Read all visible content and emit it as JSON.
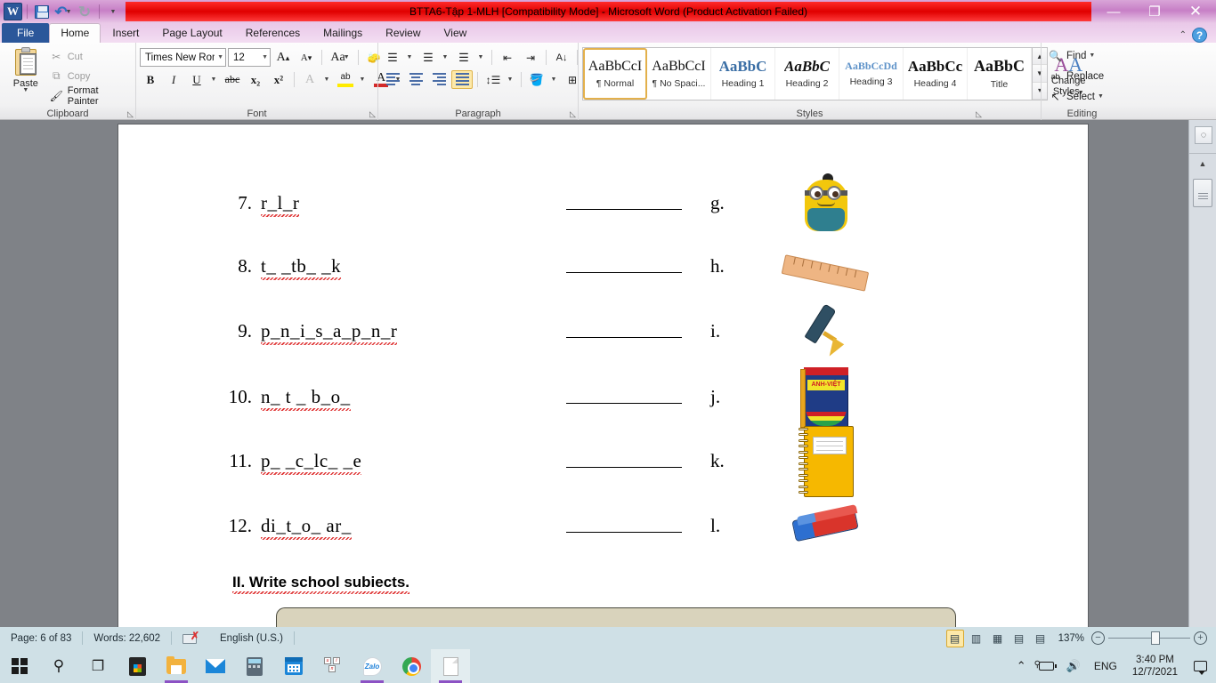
{
  "titlebar": {
    "document_title": "BTTA6-Tập 1-MLH [Compatibility Mode]  -  Microsoft Word (Product Activation Failed)",
    "app_logo": "word-logo",
    "quick_access": [
      {
        "name": "save",
        "icon": "save-icon"
      },
      {
        "name": "undo",
        "icon": "undo-icon",
        "glyph": "↰"
      },
      {
        "name": "redo",
        "icon": "redo-icon",
        "glyph": "↻"
      },
      {
        "name": "customize-qat",
        "icon": "chevron-down-icon",
        "glyph": "⋶"
      }
    ],
    "window_controls": {
      "minimize": "—",
      "restore": "❐",
      "close": "✕"
    }
  },
  "tabs": {
    "file": "File",
    "items": [
      {
        "label": "Home",
        "active": true
      },
      {
        "label": "Insert",
        "active": false
      },
      {
        "label": "Page Layout",
        "active": false
      },
      {
        "label": "References",
        "active": false
      },
      {
        "label": "Mailings",
        "active": false
      },
      {
        "label": "Review",
        "active": false
      },
      {
        "label": "View",
        "active": false
      }
    ],
    "collapse_ribbon": "⌃",
    "help": "?"
  },
  "ribbon": {
    "clipboard": {
      "group_label": "Clipboard",
      "paste_label": "Paste",
      "cut_label": "Cut",
      "copy_label": "Copy",
      "format_painter_label": "Format Painter"
    },
    "font": {
      "group_label": "Font",
      "font_name": "Times New Rom",
      "font_size": "12",
      "grow_font": "A",
      "shrink_font": "A",
      "change_case": "Aa",
      "clear_formatting": "⌫",
      "bold": "B",
      "italic": "I",
      "underline": "U",
      "strikethrough": "abc",
      "subscript": "x₂",
      "superscript": "x²",
      "text_effects": "A",
      "highlight": "ab",
      "font_color": "A"
    },
    "paragraph": {
      "group_label": "Paragraph",
      "bullets": "≔",
      "numbering": "≕",
      "multilevel": "≖",
      "decrease_indent": "⇤",
      "increase_indent": "⇥",
      "sort": "A↓",
      "show_marks": "¶",
      "align_left": "align-left",
      "align_center": "align-center",
      "align_right": "align-right",
      "justify": "justify",
      "line_spacing": "↕",
      "shading": "shading",
      "borders": "borders"
    },
    "styles": {
      "group_label": "Styles",
      "gallery": [
        {
          "preview": "AaBbCcI",
          "name": "¶ Normal",
          "selected": true
        },
        {
          "preview": "AaBbCcI",
          "name": "¶ No Spaci...",
          "selected": false
        },
        {
          "preview": "AaBbC",
          "name": "Heading 1",
          "selected": false
        },
        {
          "preview": "AaBbC",
          "name": "Heading 2",
          "selected": false
        },
        {
          "preview": "AaBbCcDd",
          "name": "Heading 3",
          "selected": false
        },
        {
          "preview": "AaBbCc",
          "name": "Heading 4",
          "selected": false
        },
        {
          "preview": "AaBbC",
          "name": "Title",
          "selected": false
        }
      ],
      "change_styles_line1": "Change",
      "change_styles_line2": "Styles"
    },
    "editing": {
      "group_label": "Editing",
      "find": "Find",
      "replace": "Replace",
      "select": "Select"
    }
  },
  "document": {
    "exercise_rows": [
      {
        "number": "7.",
        "word": "r_l_r",
        "blank": "",
        "letter": "g.",
        "picture": "backpack-image"
      },
      {
        "number": "8.",
        "word": "t_ _tb_ _k",
        "blank": "",
        "letter": "h.",
        "picture": "ruler-image"
      },
      {
        "number": "9.",
        "word": "p_n_i_s_a_p_n_r",
        "blank": "",
        "letter": "i.",
        "picture": "fountain-pen-image"
      },
      {
        "number": "10.",
        "word": "n_ t _ b_o_",
        "blank": "",
        "letter": "j.",
        "picture": "dictionary-image"
      },
      {
        "number": "11.",
        "word": "p_ _c_lc_ _e",
        "blank": "",
        "letter": "k.",
        "picture": "notebook-image"
      },
      {
        "number": "12.",
        "word": "di_t_o_ ar_",
        "blank": "",
        "letter": "l.",
        "picture": "eraser-image"
      }
    ],
    "section_heading": "II. Write school subiects."
  },
  "statusbar": {
    "page": "Page: 6 of 83",
    "words": "Words: 22,602",
    "language": "English (U.S.)",
    "proofing_icon": "spelling-errors-icon",
    "views": [
      {
        "name": "print-layout",
        "glyph": "▤",
        "active": true
      },
      {
        "name": "full-screen-reading",
        "glyph": "▥",
        "active": false
      },
      {
        "name": "web-layout",
        "glyph": "▦",
        "active": false
      },
      {
        "name": "outline",
        "glyph": "▤",
        "active": false
      },
      {
        "name": "draft",
        "glyph": "▤",
        "active": false
      }
    ],
    "zoom": "137%",
    "zoom_out": "−",
    "zoom_in": "+"
  },
  "taskbar": {
    "items": [
      {
        "name": "start",
        "icon": "windows-logo-icon",
        "state": "idle"
      },
      {
        "name": "search",
        "icon": "search-icon",
        "state": "idle"
      },
      {
        "name": "task-view",
        "icon": "task-view-icon",
        "state": "idle"
      },
      {
        "name": "microsoft-store",
        "icon": "store-icon",
        "state": "idle"
      },
      {
        "name": "file-explorer",
        "icon": "folder-icon",
        "state": "running"
      },
      {
        "name": "mail",
        "icon": "mail-icon",
        "state": "idle"
      },
      {
        "name": "calculator",
        "icon": "calculator-icon",
        "state": "idle"
      },
      {
        "name": "calendar",
        "icon": "calendar-icon",
        "state": "idle"
      },
      {
        "name": "unikey",
        "icon": "unikey-icon",
        "state": "idle"
      },
      {
        "name": "zalo",
        "icon": "zalo-icon",
        "state": "running"
      },
      {
        "name": "google-chrome",
        "icon": "chrome-icon",
        "state": "idle"
      },
      {
        "name": "microsoft-word",
        "icon": "document-icon",
        "state": "active"
      }
    ],
    "tray": {
      "show_hidden": "⌃",
      "battery": "battery-charging-icon",
      "volume": "🔊",
      "language": "ENG",
      "time": "3:40 PM",
      "date": "12/7/2021",
      "notifications": "notification-icon"
    }
  },
  "colors": {
    "title_red": "#e00000",
    "title_purple": "#c77fc6",
    "file_tab_blue": "#2b579a",
    "statusbar_blue": "#cfe0e6",
    "doc_gray": "#7f8287",
    "style_selected": "#e3b04b"
  }
}
